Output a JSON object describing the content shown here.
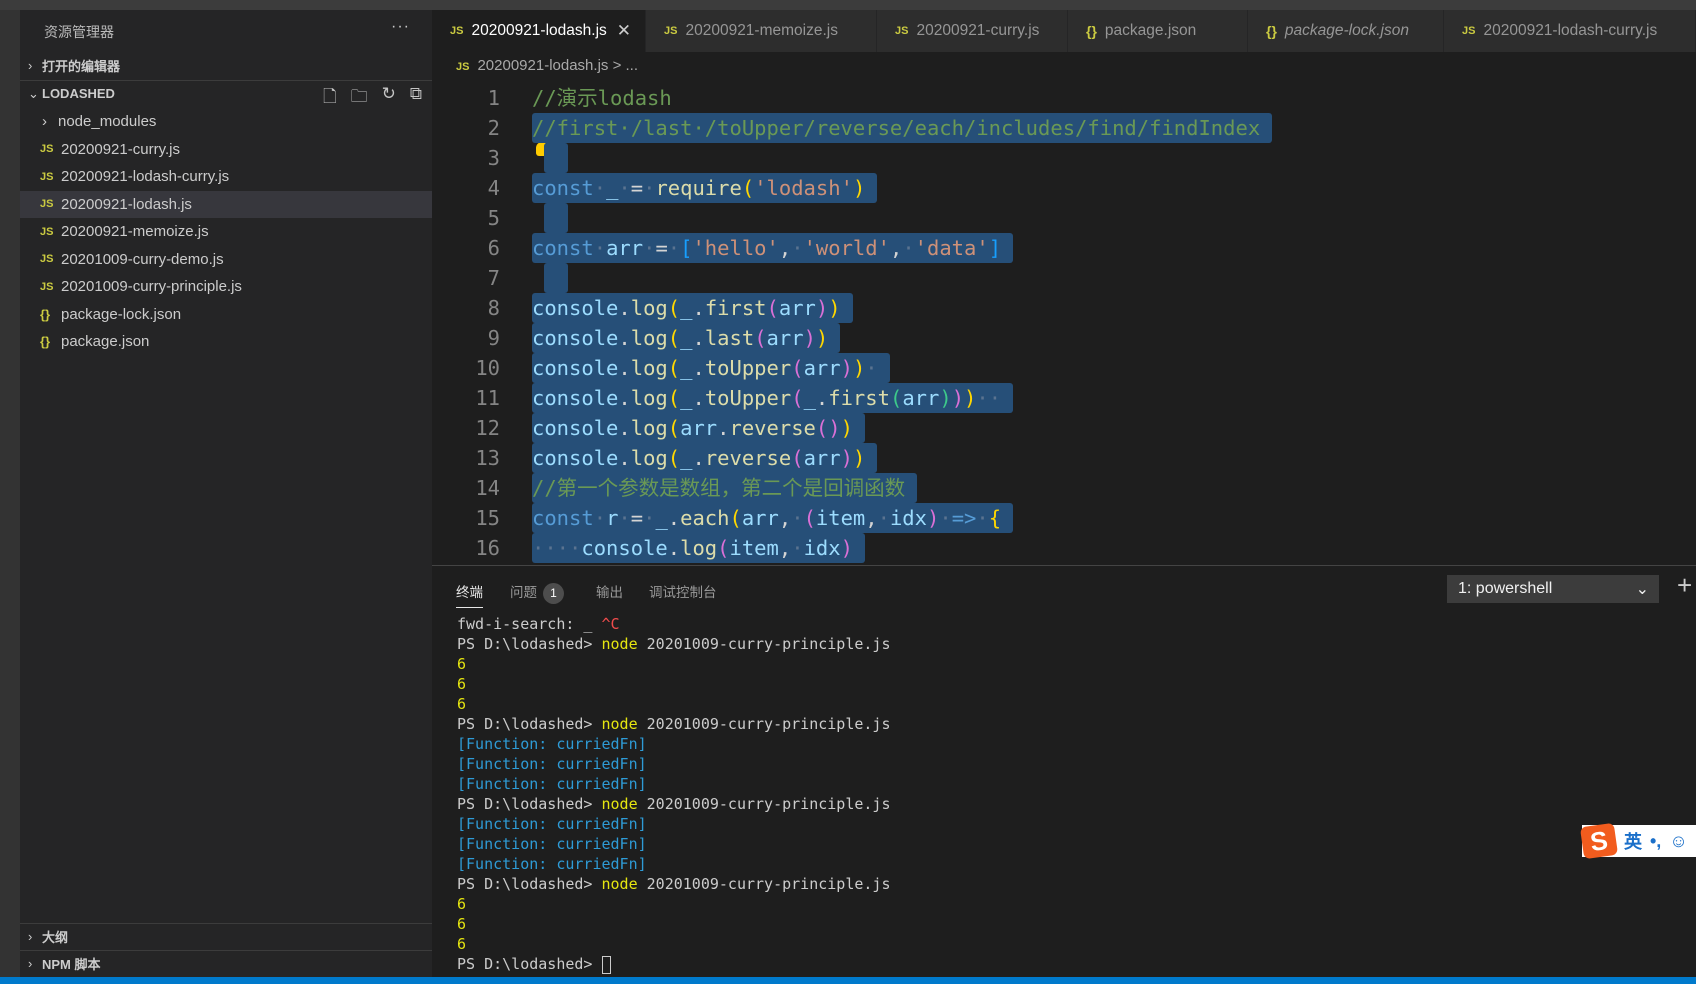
{
  "sidebar": {
    "title": "资源管理器",
    "more": "···",
    "open_editors": "打开的编辑器",
    "folder": "LODASHED",
    "actions": [
      {
        "icon": "new-file-icon",
        "glyph": "🗋"
      },
      {
        "icon": "new-folder-icon",
        "glyph": "🗀"
      },
      {
        "icon": "refresh-icon",
        "glyph": "↻"
      },
      {
        "icon": "collapse-all-icon",
        "glyph": "⧉"
      }
    ],
    "files": [
      {
        "name": "node_modules",
        "type": "folder"
      },
      {
        "name": "20200921-curry.js",
        "type": "js"
      },
      {
        "name": "20200921-lodash-curry.js",
        "type": "js"
      },
      {
        "name": "20200921-lodash.js",
        "type": "js",
        "selected": true
      },
      {
        "name": "20200921-memoize.js",
        "type": "js"
      },
      {
        "name": "20201009-curry-demo.js",
        "type": "js"
      },
      {
        "name": "20201009-curry-principle.js",
        "type": "js"
      },
      {
        "name": "package-lock.json",
        "type": "json"
      },
      {
        "name": "package.json",
        "type": "json"
      }
    ],
    "outline": "大纲",
    "npm": "NPM 脚本"
  },
  "tabs": [
    {
      "label": "20200921-lodash.js",
      "type": "js",
      "active": true,
      "w": 214
    },
    {
      "label": "20200921-memoize.js",
      "type": "js",
      "w": 231
    },
    {
      "label": "20200921-curry.js",
      "type": "js",
      "w": 191
    },
    {
      "label": "package.json",
      "type": "json",
      "w": 180
    },
    {
      "label": "package-lock.json",
      "type": "json",
      "italic": true,
      "w": 196
    },
    {
      "label": "20200921-lodash-curry.js",
      "type": "js",
      "w": 252
    }
  ],
  "breadcrumb": {
    "file": "20200921-lodash.js",
    "rest": " > ..."
  },
  "code": [
    {
      "n": "1",
      "s": false,
      "t": [
        [
          "//演示lodash",
          "cm"
        ]
      ]
    },
    {
      "n": "2",
      "s": true,
      "t": [
        [
          "//first·/last·/toUpper/reverse/each/includes/find/findIndex",
          "cm"
        ]
      ]
    },
    {
      "n": "3",
      "s": true,
      "t": [
        [
          " ",
          "pl"
        ]
      ]
    },
    {
      "n": "4",
      "s": true,
      "t": [
        [
          "const",
          "kw"
        ],
        [
          "·",
          "ws"
        ],
        [
          "_",
          "va"
        ],
        [
          "·",
          "ws"
        ],
        [
          "=",
          "pl"
        ],
        [
          "·",
          "ws"
        ],
        [
          "require",
          "fn"
        ],
        [
          "(",
          "b1"
        ],
        [
          "'lodash'",
          "st"
        ],
        [
          ")",
          "b1"
        ]
      ]
    },
    {
      "n": "5",
      "s": true,
      "t": [
        [
          " ",
          "pl"
        ]
      ]
    },
    {
      "n": "6",
      "s": true,
      "t": [
        [
          "const",
          "kw"
        ],
        [
          "·",
          "ws"
        ],
        [
          "arr",
          "va"
        ],
        [
          "·",
          "ws"
        ],
        [
          "=",
          "pl"
        ],
        [
          "·",
          "ws"
        ],
        [
          "[",
          "b3"
        ],
        [
          "'hello'",
          "st"
        ],
        [
          ",",
          "pl"
        ],
        [
          "·",
          "ws"
        ],
        [
          "'world'",
          "st"
        ],
        [
          ",",
          "pl"
        ],
        [
          "·",
          "ws"
        ],
        [
          "'data'",
          "st"
        ],
        [
          "]",
          "b3"
        ]
      ]
    },
    {
      "n": "7",
      "s": true,
      "t": [
        [
          " ",
          "pl"
        ]
      ]
    },
    {
      "n": "8",
      "s": true,
      "t": [
        [
          "console",
          "va"
        ],
        [
          ".",
          "pl"
        ],
        [
          "log",
          "fn"
        ],
        [
          "(",
          "b1"
        ],
        [
          "_",
          "va"
        ],
        [
          ".",
          "pl"
        ],
        [
          "first",
          "fn"
        ],
        [
          "(",
          "b2"
        ],
        [
          "arr",
          "va"
        ],
        [
          ")",
          "b2"
        ],
        [
          ")",
          "b1"
        ]
      ]
    },
    {
      "n": "9",
      "s": true,
      "t": [
        [
          "console",
          "va"
        ],
        [
          ".",
          "pl"
        ],
        [
          "log",
          "fn"
        ],
        [
          "(",
          "b1"
        ],
        [
          "_",
          "va"
        ],
        [
          ".",
          "pl"
        ],
        [
          "last",
          "fn"
        ],
        [
          "(",
          "b2"
        ],
        [
          "arr",
          "va"
        ],
        [
          ")",
          "b2"
        ],
        [
          ")",
          "b1"
        ]
      ]
    },
    {
      "n": "10",
      "s": true,
      "t": [
        [
          "console",
          "va"
        ],
        [
          ".",
          "pl"
        ],
        [
          "log",
          "fn"
        ],
        [
          "(",
          "b1"
        ],
        [
          "_",
          "va"
        ],
        [
          ".",
          "pl"
        ],
        [
          "toUpper",
          "fn"
        ],
        [
          "(",
          "b2"
        ],
        [
          "arr",
          "va"
        ],
        [
          ")",
          "b2"
        ],
        [
          ")",
          "b1"
        ],
        [
          "·",
          "ws"
        ]
      ]
    },
    {
      "n": "11",
      "s": true,
      "t": [
        [
          "console",
          "va"
        ],
        [
          ".",
          "pl"
        ],
        [
          "log",
          "fn"
        ],
        [
          "(",
          "b1"
        ],
        [
          "_",
          "va"
        ],
        [
          ".",
          "pl"
        ],
        [
          "toUpper",
          "fn"
        ],
        [
          "(",
          "b2"
        ],
        [
          "_",
          "va"
        ],
        [
          ".",
          "pl"
        ],
        [
          "first",
          "fn"
        ],
        [
          "(",
          "b4"
        ],
        [
          "arr",
          "va"
        ],
        [
          ")",
          "b4"
        ],
        [
          ")",
          "b2"
        ],
        [
          ")",
          "b1"
        ],
        [
          "··",
          "ws"
        ]
      ]
    },
    {
      "n": "12",
      "s": true,
      "t": [
        [
          "console",
          "va"
        ],
        [
          ".",
          "pl"
        ],
        [
          "log",
          "fn"
        ],
        [
          "(",
          "b1"
        ],
        [
          "arr",
          "va"
        ],
        [
          ".",
          "pl"
        ],
        [
          "reverse",
          "fn"
        ],
        [
          "()",
          "b2"
        ],
        [
          ")",
          "b1"
        ]
      ]
    },
    {
      "n": "13",
      "s": true,
      "t": [
        [
          "console",
          "va"
        ],
        [
          ".",
          "pl"
        ],
        [
          "log",
          "fn"
        ],
        [
          "(",
          "b1"
        ],
        [
          "_",
          "va"
        ],
        [
          ".",
          "pl"
        ],
        [
          "reverse",
          "fn"
        ],
        [
          "(",
          "b2"
        ],
        [
          "arr",
          "va"
        ],
        [
          ")",
          "b2"
        ],
        [
          ")",
          "b1"
        ]
      ]
    },
    {
      "n": "14",
      "s": true,
      "t": [
        [
          "//第一个参数是数组，第二个是回调函数",
          "cm"
        ]
      ]
    },
    {
      "n": "15",
      "s": true,
      "t": [
        [
          "const",
          "kw"
        ],
        [
          "·",
          "ws"
        ],
        [
          "r",
          "va"
        ],
        [
          "·",
          "ws"
        ],
        [
          "=",
          "pl"
        ],
        [
          "·",
          "ws"
        ],
        [
          "_",
          "va"
        ],
        [
          ".",
          "pl"
        ],
        [
          "each",
          "fn"
        ],
        [
          "(",
          "b1"
        ],
        [
          "arr",
          "va"
        ],
        [
          ",",
          "pl"
        ],
        [
          "·",
          "ws"
        ],
        [
          "(",
          "b2"
        ],
        [
          "item",
          "va"
        ],
        [
          ",",
          "pl"
        ],
        [
          "·",
          "ws"
        ],
        [
          "idx",
          "va"
        ],
        [
          ")",
          "b2"
        ],
        [
          "·",
          "ws"
        ],
        [
          "=>",
          "kw"
        ],
        [
          "·",
          "ws"
        ],
        [
          "{",
          "b1"
        ]
      ]
    },
    {
      "n": "16",
      "s": true,
      "t": [
        [
          "····",
          "ws"
        ],
        [
          "console",
          "va"
        ],
        [
          ".",
          "pl"
        ],
        [
          "log",
          "fn"
        ],
        [
          "(",
          "b2"
        ],
        [
          "item",
          "va"
        ],
        [
          ",",
          "pl"
        ],
        [
          "·",
          "ws"
        ],
        [
          "idx",
          "va"
        ],
        [
          ")",
          "b2"
        ]
      ]
    }
  ],
  "panel": {
    "tabs": [
      {
        "label": "终端",
        "active": true
      },
      {
        "label": "问题",
        "badge": "1"
      },
      {
        "label": "输出"
      },
      {
        "label": "调试控制台"
      }
    ],
    "shell": "1: powershell",
    "plus": "+"
  },
  "terminal": [
    [
      [
        "fwd-i-search: _ ",
        "tw"
      ],
      [
        "^C",
        "tr"
      ]
    ],
    [
      [
        "PS D:\\lodashed> ",
        "tw"
      ],
      [
        "node",
        "ty"
      ],
      [
        " 20201009-curry-principle.js",
        "tw"
      ]
    ],
    [
      [
        "6",
        "ty"
      ]
    ],
    [
      [
        "6",
        "ty"
      ]
    ],
    [
      [
        "6",
        "ty"
      ]
    ],
    [
      [
        "PS D:\\lodashed> ",
        "tw"
      ],
      [
        "node",
        "ty"
      ],
      [
        " 20201009-curry-principle.js",
        "tw"
      ]
    ],
    [
      [
        "[Function: curriedFn]",
        "tb"
      ]
    ],
    [
      [
        "[Function: curriedFn]",
        "tb"
      ]
    ],
    [
      [
        "[Function: curriedFn]",
        "tb"
      ]
    ],
    [
      [
        "PS D:\\lodashed> ",
        "tw"
      ],
      [
        "node",
        "ty"
      ],
      [
        " 20201009-curry-principle.js",
        "tw"
      ]
    ],
    [
      [
        "[Function: curriedFn]",
        "tb"
      ]
    ],
    [
      [
        "[Function: curriedFn]",
        "tb"
      ]
    ],
    [
      [
        "[Function: curriedFn]",
        "tb"
      ]
    ],
    [
      [
        "PS D:\\lodashed> ",
        "tw"
      ],
      [
        "node",
        "ty"
      ],
      [
        " 20201009-curry-principle.js",
        "tw"
      ]
    ],
    [
      [
        "6",
        "ty"
      ]
    ],
    [
      [
        "6",
        "ty"
      ]
    ],
    [
      [
        "6",
        "ty"
      ]
    ],
    [
      [
        "PS D:\\lodashed> ",
        "tw"
      ]
    ]
  ],
  "ime": {
    "logo": "S",
    "lang": "英",
    "punct": "•,",
    "emoji": "☺"
  },
  "colors": {
    "accent": "#007acc",
    "selection": "#264f78",
    "js_icon": "#cbcb41"
  }
}
